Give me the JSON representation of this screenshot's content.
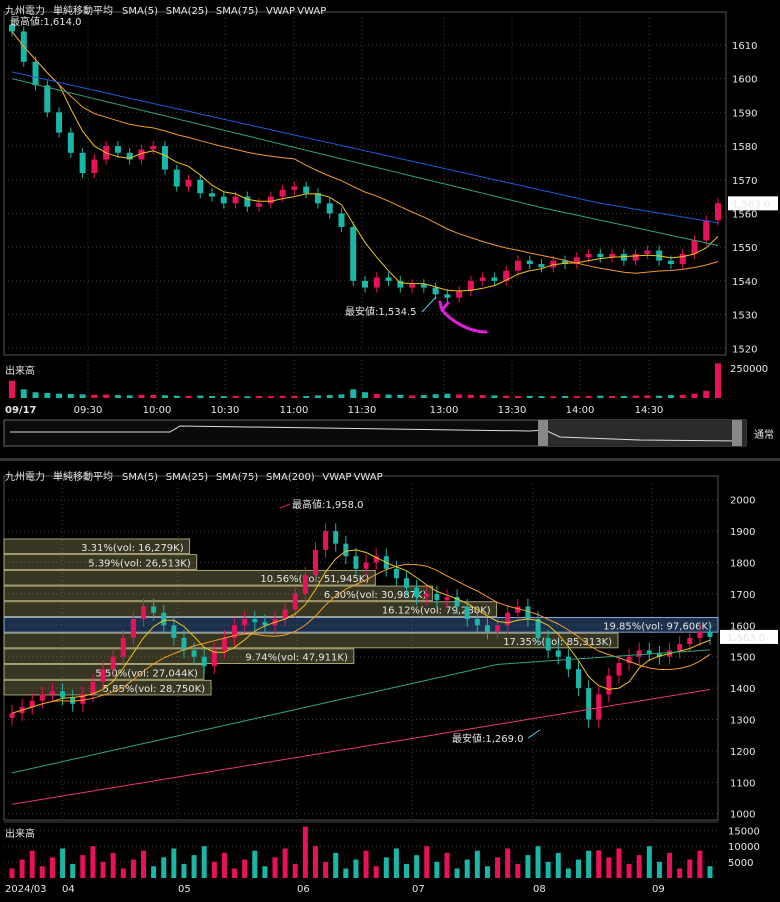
{
  "colors": {
    "up": "#e8115a",
    "down": "#19b7a8",
    "sma5": "#f0c419",
    "sma25": "#f09b2a",
    "sma75": "#2fa37d",
    "sma200": "#e23a6c",
    "vwap": "#1b5bd6",
    "vwap_green": "#2dbf4a",
    "grid": "#3a3a3a",
    "axis": "#cfcfcf",
    "zone": "#c7c27a",
    "zone_hl": "#3f6aa8",
    "cyan": "#48d7e6"
  },
  "intraday": {
    "legend": {
      "name": "九州電力",
      "indicator": "単純移動平均",
      "sma5": "SMA(5)",
      "sma25": "SMA(25)",
      "sma75": "SMA(75)",
      "vwap1": "VWAP",
      "vwap2": "VWAP"
    },
    "high_label": "最高値:1,614.0",
    "low_label": "最安値:1,534.5",
    "last_price": "1,563.0",
    "volume_title": "出来高",
    "volume_max_label": "250000",
    "date_label": "09/17",
    "switch_label": "通常"
  },
  "daily": {
    "legend": {
      "name": "九州電力",
      "indicator": "単純移動平均",
      "sma5": "SMA(5)",
      "sma25": "SMA(25)",
      "sma75": "SMA(75)",
      "sma200": "SMA(200)",
      "vwap1": "VWAP",
      "vwap2": "VWAP"
    },
    "high_label": "最高値:1,958.0",
    "low_label": "最安値:1,269.0",
    "last_price": "1,563.0",
    "volume_title": "出来高",
    "first_x_label": "2024/03"
  },
  "chart_data": [
    {
      "type": "candlestick",
      "ylim": [
        1518,
        1618
      ],
      "yticks": [
        1520,
        1530,
        1540,
        1550,
        1560,
        1570,
        1580,
        1590,
        1600,
        1610
      ],
      "xticks": [
        "09:30",
        "10:00",
        "10:30",
        "11:00",
        "11:30",
        "13:00",
        "13:30",
        "14:00",
        "14:30"
      ],
      "close_series": [
        1614,
        1605,
        1598,
        1590,
        1584,
        1578,
        1572,
        1576,
        1580,
        1578,
        1576,
        1579,
        1580,
        1573,
        1568,
        1570,
        1566,
        1565,
        1563,
        1565,
        1562,
        1563,
        1565,
        1567,
        1568,
        1566,
        1563,
        1560,
        1556,
        1540,
        1538,
        1541,
        1540,
        1538,
        1539,
        1538,
        1536,
        1535,
        1537,
        1540,
        1541,
        1540,
        1543,
        1546,
        1545,
        1544,
        1546,
        1545,
        1547,
        1548,
        1547,
        1548,
        1546,
        1548,
        1549,
        1546,
        1545,
        1548,
        1552,
        1558,
        1563
      ],
      "volume_max": 250000,
      "volume": [
        120000,
        60000,
        40000,
        35000,
        30000,
        28000,
        25000,
        22000,
        24000,
        20000,
        18000,
        22000,
        21000,
        19000,
        16000,
        15000,
        17000,
        14000,
        13000,
        15000,
        12000,
        14000,
        13000,
        16000,
        15000,
        14000,
        18000,
        20000,
        25000,
        60000,
        40000,
        28000,
        24000,
        22000,
        18000,
        20000,
        26000,
        30000,
        25000,
        22000,
        20000,
        18000,
        16000,
        14000,
        15000,
        13000,
        12000,
        14000,
        13000,
        15000,
        16000,
        14000,
        15000,
        17000,
        18000,
        16000,
        20000,
        22000,
        30000,
        50000,
        240000
      ]
    },
    {
      "type": "candlestick",
      "ylim": [
        980,
        2050
      ],
      "yticks": [
        1000,
        1100,
        1200,
        1300,
        1400,
        1500,
        1600,
        1700,
        1800,
        1900,
        2000
      ],
      "xticks": [
        "04",
        "05",
        "06",
        "07",
        "08",
        "09"
      ],
      "close_series": [
        1320,
        1340,
        1360,
        1380,
        1390,
        1370,
        1350,
        1380,
        1420,
        1460,
        1500,
        1560,
        1620,
        1660,
        1640,
        1600,
        1560,
        1520,
        1500,
        1470,
        1520,
        1560,
        1600,
        1620,
        1610,
        1600,
        1620,
        1650,
        1700,
        1760,
        1840,
        1900,
        1860,
        1820,
        1780,
        1800,
        1820,
        1780,
        1750,
        1720,
        1690,
        1700,
        1680,
        1690,
        1660,
        1620,
        1600,
        1580,
        1600,
        1640,
        1660,
        1620,
        1560,
        1520,
        1500,
        1460,
        1400,
        1300,
        1380,
        1440,
        1480,
        1500,
        1520,
        1510,
        1500,
        1520,
        1540,
        1560,
        1580,
        1563
      ],
      "price_zones": [
        {
          "label": "3.31%(vol: 16,279K)",
          "price": 1850
        },
        {
          "label": "5.39%(vol: 26,513K)",
          "price": 1800
        },
        {
          "label": "10.56%(vol: 51,945K)",
          "price": 1750
        },
        {
          "label": "6.30%(vol: 30,987K)",
          "price": 1700
        },
        {
          "label": "16.12%(vol: 79,280K)",
          "price": 1650
        },
        {
          "label": "19.85%(vol: 97,606K)",
          "price": 1600
        },
        {
          "label": "17.35%(vol: 85,313K)",
          "price": 1550
        },
        {
          "label": "9.74%(vol: 47,911K)",
          "price": 1500
        },
        {
          "label": "5.50%(vol: 27,044K)",
          "price": 1450
        },
        {
          "label": "5.85%(vol: 28,750K)",
          "price": 1400
        }
      ],
      "volume_ticks": [
        5000,
        10000,
        15000
      ],
      "volume_max": 17000
    }
  ]
}
